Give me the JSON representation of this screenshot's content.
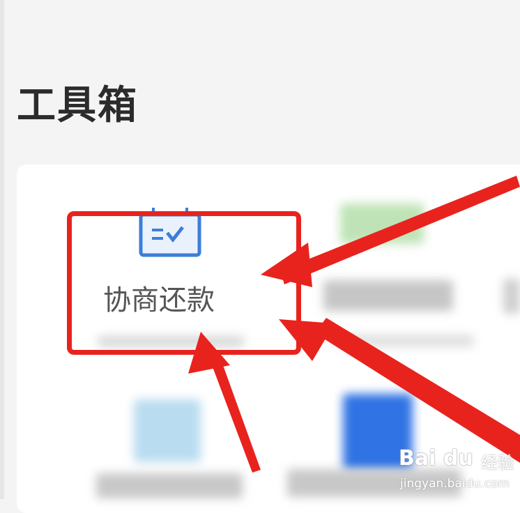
{
  "toolbox": {
    "title": "工具箱",
    "tools": [
      {
        "label": "协商还款",
        "icon": "calendar-check-icon"
      },
      {
        "label": "",
        "icon": "blurred-green-icon"
      },
      {
        "label": "",
        "icon": "blurred-light-blue-icon"
      },
      {
        "label": "",
        "icon": "blurred-blue-icon"
      }
    ]
  },
  "annotation": {
    "color": "#e8231d"
  },
  "watermark": {
    "logo": "Bai du",
    "brand": "经验",
    "url": "jingyan.baidu.com"
  }
}
